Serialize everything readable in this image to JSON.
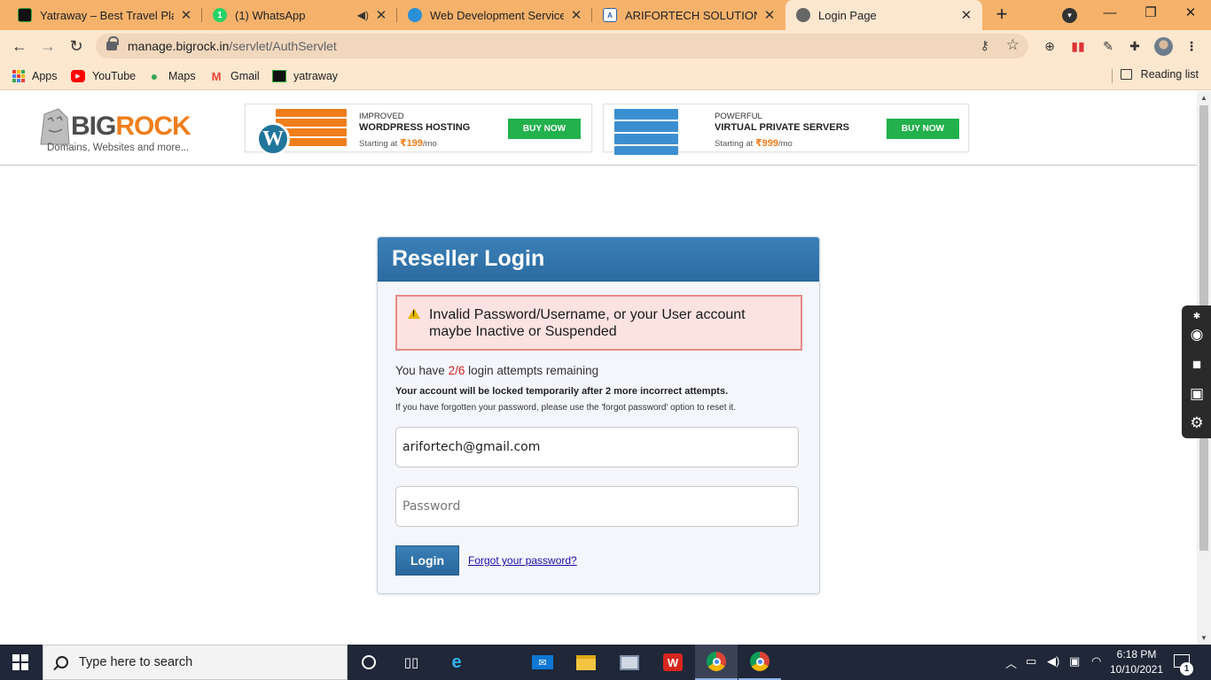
{
  "browser": {
    "tabs": [
      {
        "title": "Yatraway – Best Travel Planner",
        "icon": "yatraway-favicon",
        "closable": true
      },
      {
        "title": "(1) WhatsApp",
        "icon": "whatsapp-favicon",
        "badge": "1",
        "audio": true,
        "closable": true
      },
      {
        "title": "Web Development Services | ",
        "icon": "webdev-favicon",
        "closable": true
      },
      {
        "title": "ARIFORTECH SOLUTION PVT. LTD",
        "icon": "arifortech-favicon",
        "closable": true
      },
      {
        "title": "Login Page",
        "icon": "globe-favicon",
        "closable": true,
        "active": true
      }
    ],
    "new_tab": "+",
    "address": {
      "host": "manage.bigrock.in",
      "path": "/servlet/AuthServlet"
    },
    "bookmarks": [
      {
        "label": "Apps",
        "icon": "apps-grid-icon"
      },
      {
        "label": "YouTube",
        "icon": "youtube-icon"
      },
      {
        "label": "Maps",
        "icon": "maps-pin-icon"
      },
      {
        "label": "Gmail",
        "icon": "gmail-icon"
      },
      {
        "label": "yatraway",
        "icon": "yatraway-icon"
      }
    ],
    "reading_list": "Reading list"
  },
  "site": {
    "logo": {
      "big": "BIG",
      "rock": "ROCK",
      "tagline": "Domains, Websites and more..."
    },
    "promos": [
      {
        "kicker": "IMPROVED",
        "headline": "WORDPRESS HOSTING",
        "price_prefix": "Starting at ",
        "price": "₹199",
        "price_suffix": "/mo",
        "button": "BUY NOW",
        "accent": "#f07e1b"
      },
      {
        "kicker": "POWERFUL",
        "headline": "VIRTUAL PRIVATE SERVERS",
        "price_prefix": "Starting at ",
        "price": "₹999",
        "price_suffix": "/mo",
        "button": "BUY NOW",
        "accent": "#3b8fd0"
      }
    ]
  },
  "login": {
    "title": "Reseller Login",
    "error": "Invalid Password/Username, or your User account maybe Inactive or Suspended",
    "attempts_prefix": "You have ",
    "attempts_count": "2/6",
    "attempts_suffix": " login attempts remaining",
    "lock_warning": "Your account will be locked temporarily after 2 more incorrect attempts.",
    "forgot_note": "If you have forgotten your password, please use the 'forgot password' option to reset it.",
    "username_value": "arifortech@gmail.com",
    "password_placeholder": "Password",
    "login_button": "Login",
    "forgot_link": "Forgot your password?"
  },
  "taskbar": {
    "search_placeholder": "Type here to search",
    "time": "6:18 PM",
    "date": "10/10/2021",
    "notifications": "1"
  },
  "colors": {
    "tab_strip": "#f6b26b",
    "toolbar": "#fde7cf",
    "login_header": "#2f72a8",
    "error_border": "#e88a86",
    "buy_button": "#22b14c",
    "taskbar": "#1f2738"
  }
}
